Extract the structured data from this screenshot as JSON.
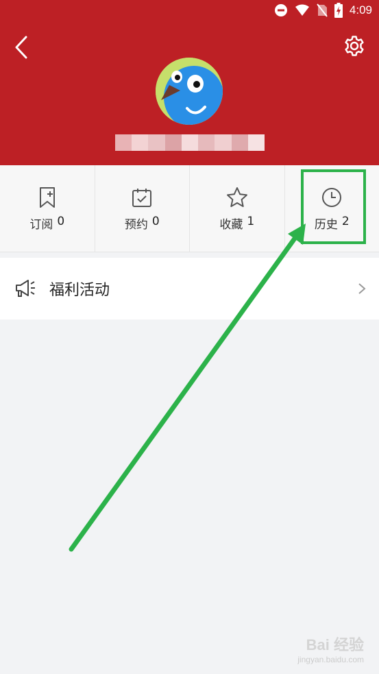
{
  "status_bar": {
    "time": "4:09",
    "icons": [
      "do-not-disturb-icon",
      "wifi-icon",
      "no-sim-icon",
      "battery-charging-icon"
    ]
  },
  "header": {
    "back_icon": "chevron-left-icon",
    "settings_icon": "gear-icon",
    "avatar_icon": "bird-avatar",
    "username_blurred": true,
    "bg_color": "#bd2025"
  },
  "stats": [
    {
      "label": "订阅",
      "count": "0",
      "icon": "bookmark-plus-icon"
    },
    {
      "label": "预约",
      "count": "0",
      "icon": "calendar-check-icon"
    },
    {
      "label": "收藏",
      "count": "1",
      "icon": "star-icon"
    },
    {
      "label": "历史",
      "count": "2",
      "icon": "clock-icon"
    }
  ],
  "menu": {
    "welfare": {
      "label": "福利活动",
      "icon": "megaphone-icon"
    }
  },
  "annotation": {
    "highlight_color": "#2cb24a",
    "target": "历史"
  },
  "watermark": {
    "main": "Bai 经验",
    "sub": "jingyan.baidu.com"
  }
}
